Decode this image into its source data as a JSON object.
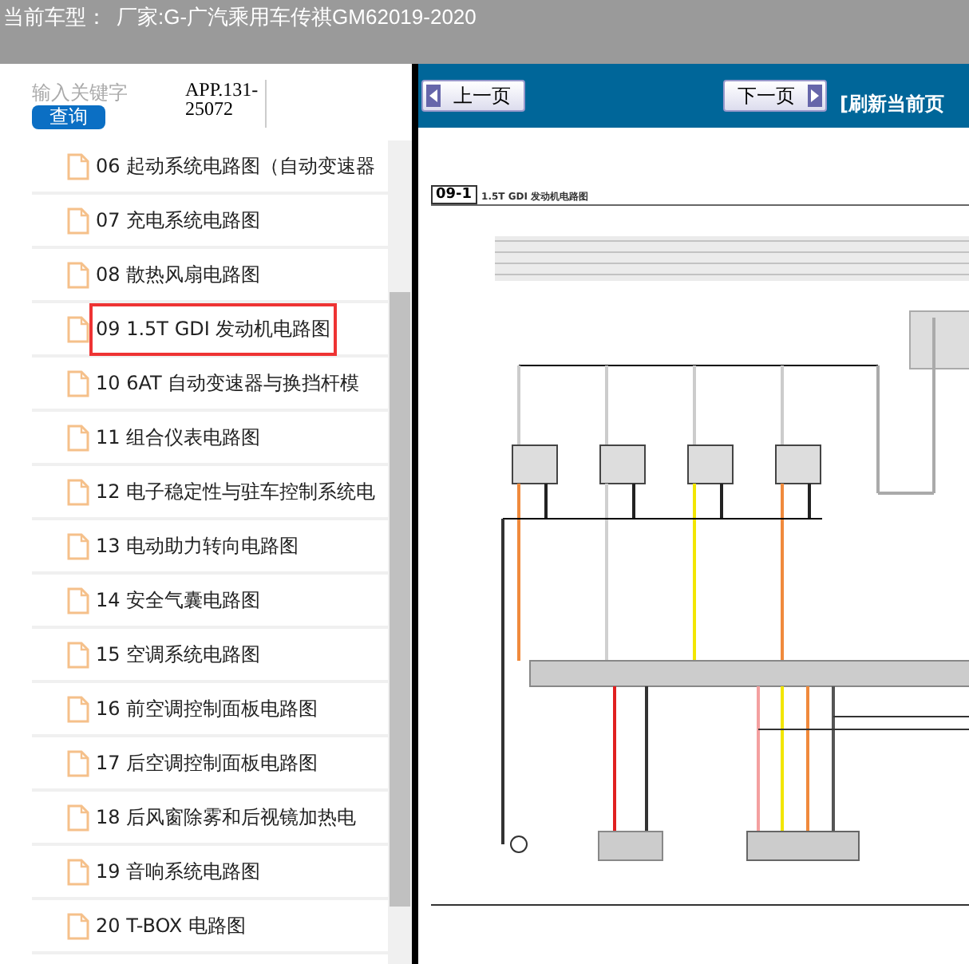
{
  "top_bar": {
    "label": "当前车型：",
    "model": "厂家:G-广汽乘用车传祺GM62019-2020"
  },
  "search": {
    "placeholder": "输入关键字",
    "button": "查询",
    "code": "APP.131-25072"
  },
  "items": [
    {
      "label": "06 起动系统电路图（自动变速器",
      "selected": false
    },
    {
      "label": "07 充电系统电路图",
      "selected": false
    },
    {
      "label": "08 散热风扇电路图",
      "selected": false
    },
    {
      "label": "09 1.5T GDI 发动机电路图",
      "selected": true
    },
    {
      "label": "10 6AT 自动变速器与换挡杆模",
      "selected": false
    },
    {
      "label": "11 组合仪表电路图",
      "selected": false
    },
    {
      "label": "12 电子稳定性与驻车控制系统电",
      "selected": false
    },
    {
      "label": "13 电动助力转向电路图",
      "selected": false
    },
    {
      "label": "14 安全气囊电路图",
      "selected": false
    },
    {
      "label": "15 空调系统电路图",
      "selected": false
    },
    {
      "label": "16 前空调控制面板电路图",
      "selected": false
    },
    {
      "label": "17 后空调控制面板电路图",
      "selected": false
    },
    {
      "label": "18 后风窗除雾和后视镜加热电",
      "selected": false
    },
    {
      "label": "19 音响系统电路图",
      "selected": false
    },
    {
      "label": "20 T-BOX 电路图",
      "selected": false
    }
  ],
  "nav": {
    "prev": "上一页",
    "next": "下一页",
    "refresh": "[刷新当前页"
  },
  "document": {
    "code": "09-1",
    "title": "1.5T GDI 发动机电路图"
  }
}
